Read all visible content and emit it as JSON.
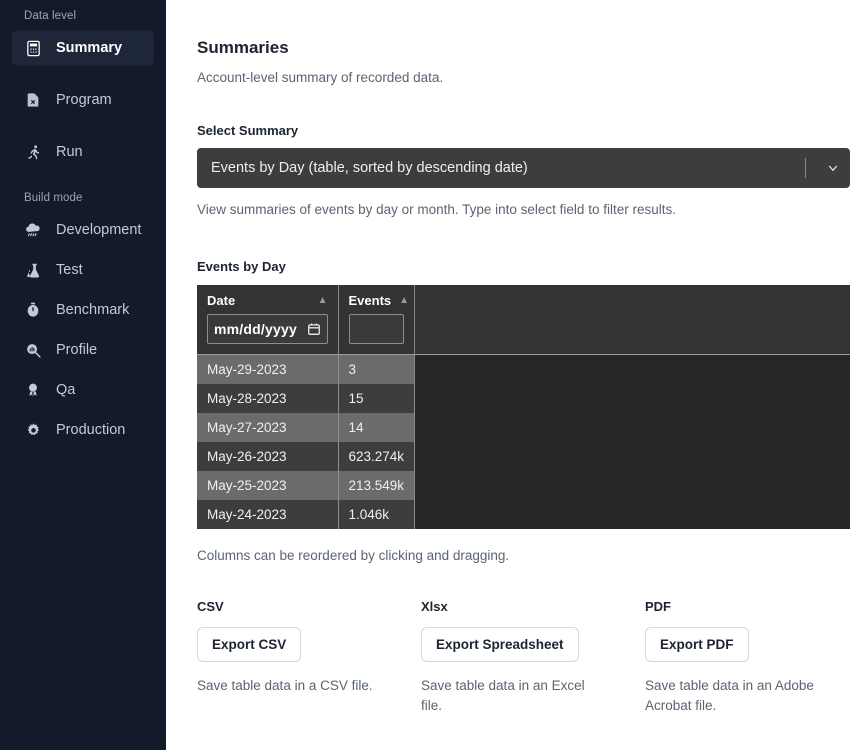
{
  "sidebar": {
    "groups": [
      {
        "label": "Data level",
        "items": [
          {
            "label": "Summary",
            "icon": "calculator-icon",
            "active": true
          },
          {
            "label": "Program",
            "icon": "file-x-icon",
            "active": false
          },
          {
            "label": "Run",
            "icon": "running-person-icon",
            "active": false
          }
        ]
      },
      {
        "label": "Build mode",
        "items": [
          {
            "label": "Development",
            "icon": "cloud-rain-icon",
            "active": false
          },
          {
            "label": "Test",
            "icon": "flask-icon",
            "active": false
          },
          {
            "label": "Benchmark",
            "icon": "stopwatch-icon",
            "active": false
          },
          {
            "label": "Profile",
            "icon": "magnifier-chart-icon",
            "active": false
          },
          {
            "label": "Qa",
            "icon": "award-badge-icon",
            "active": false
          },
          {
            "label": "Production",
            "icon": "gear-icon",
            "active": false
          }
        ]
      }
    ]
  },
  "main": {
    "title": "Summaries",
    "subtitle": "Account-level summary of recorded data.",
    "select_summary": {
      "label": "Select Summary",
      "value": "Events by Day (table, sorted by descending date)",
      "helper": "View summaries of events by day or month. Type into select field to filter results."
    },
    "table": {
      "title": "Events by Day",
      "columns": [
        {
          "header": "Date",
          "sort": "ascending"
        },
        {
          "header": "Events",
          "sort": "ascending"
        }
      ],
      "filters": {
        "date_placeholder": "mm/dd/yyyy",
        "date_value": "",
        "events_value": ""
      },
      "rows": [
        {
          "date": "May-29-2023",
          "events": "3"
        },
        {
          "date": "May-28-2023",
          "events": "15"
        },
        {
          "date": "May-27-2023",
          "events": "14"
        },
        {
          "date": "May-26-2023",
          "events": "623.274k"
        },
        {
          "date": "May-25-2023",
          "events": "213.549k"
        },
        {
          "date": "May-24-2023",
          "events": "1.046k"
        }
      ],
      "note": "Columns can be reordered by clicking and dragging."
    },
    "exports": [
      {
        "heading": "CSV",
        "button": "Export CSV",
        "description": "Save table data in a CSV file."
      },
      {
        "heading": "Xlsx",
        "button": "Export Spreadsheet",
        "description": "Save table data in an Excel file."
      },
      {
        "heading": "PDF",
        "button": "Export PDF",
        "description": "Save table data in an Adobe Acrobat file."
      }
    ]
  },
  "colors": {
    "sidebar_bg": "#151a2b",
    "sidebar_active_bg": "#1e2639",
    "select_bg": "#3d3d3d",
    "table_bg": "#262626",
    "table_header_bg": "#333333",
    "row_odd_bg": "#6b6b6b",
    "row_even_bg": "#3d3d3d",
    "text_muted": "#5a6472"
  }
}
